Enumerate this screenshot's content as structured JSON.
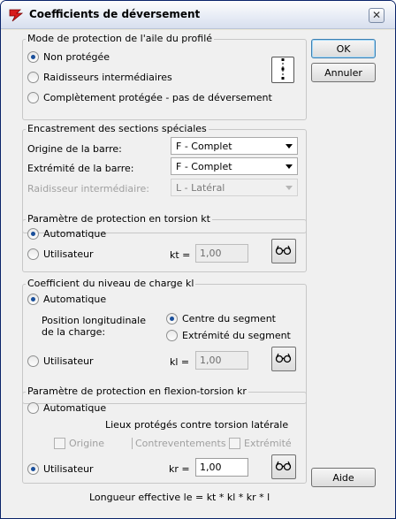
{
  "window": {
    "title": "Coefficients de déversement",
    "close": "✕"
  },
  "buttons": {
    "ok": "OK",
    "cancel": "Annuler",
    "help": "Aide"
  },
  "group1": {
    "title": "Mode de protection de l'aile du profilé",
    "options": [
      "Non protégée",
      "Raidisseurs intermédiaires",
      "Complètement protégée - pas de déversement"
    ],
    "selected": 0
  },
  "group2": {
    "title": "Encastrement des sections spéciales",
    "origin_label": "Origine de la barre:",
    "origin_value": "F - Complet",
    "end_label": "Extrémité de la barre:",
    "end_value": "F - Complet",
    "stiffener_label": "Raidisseur intermédiaire:",
    "stiffener_value": "L - Latéral"
  },
  "group3": {
    "title": "Paramètre de protection en torsion kt",
    "auto": "Automatique",
    "user": "Utilisateur",
    "field_label": "kt =",
    "field_value": "1,00"
  },
  "group4": {
    "title": "Coefficient du niveau de charge kl",
    "auto": "Automatique",
    "position_label": "Position longitudinale de la charge:",
    "center": "Centre du segment",
    "end": "Extrémité du segment",
    "user": "Utilisateur",
    "field_label": "kl =",
    "field_value": "1,00"
  },
  "group5": {
    "title": "Paramètre de protection en flexion-torsion kr",
    "auto": "Automatique",
    "places_label": "Lieux protégés contre torsion latérale",
    "check_origin": "Origine",
    "check_bracing": "Contreventements",
    "check_end": "Extrémité",
    "user": "Utilisateur",
    "field_label": "kr =",
    "field_value": "1,00"
  },
  "formula": "Longueur effective le = kt * kl * kr * l"
}
